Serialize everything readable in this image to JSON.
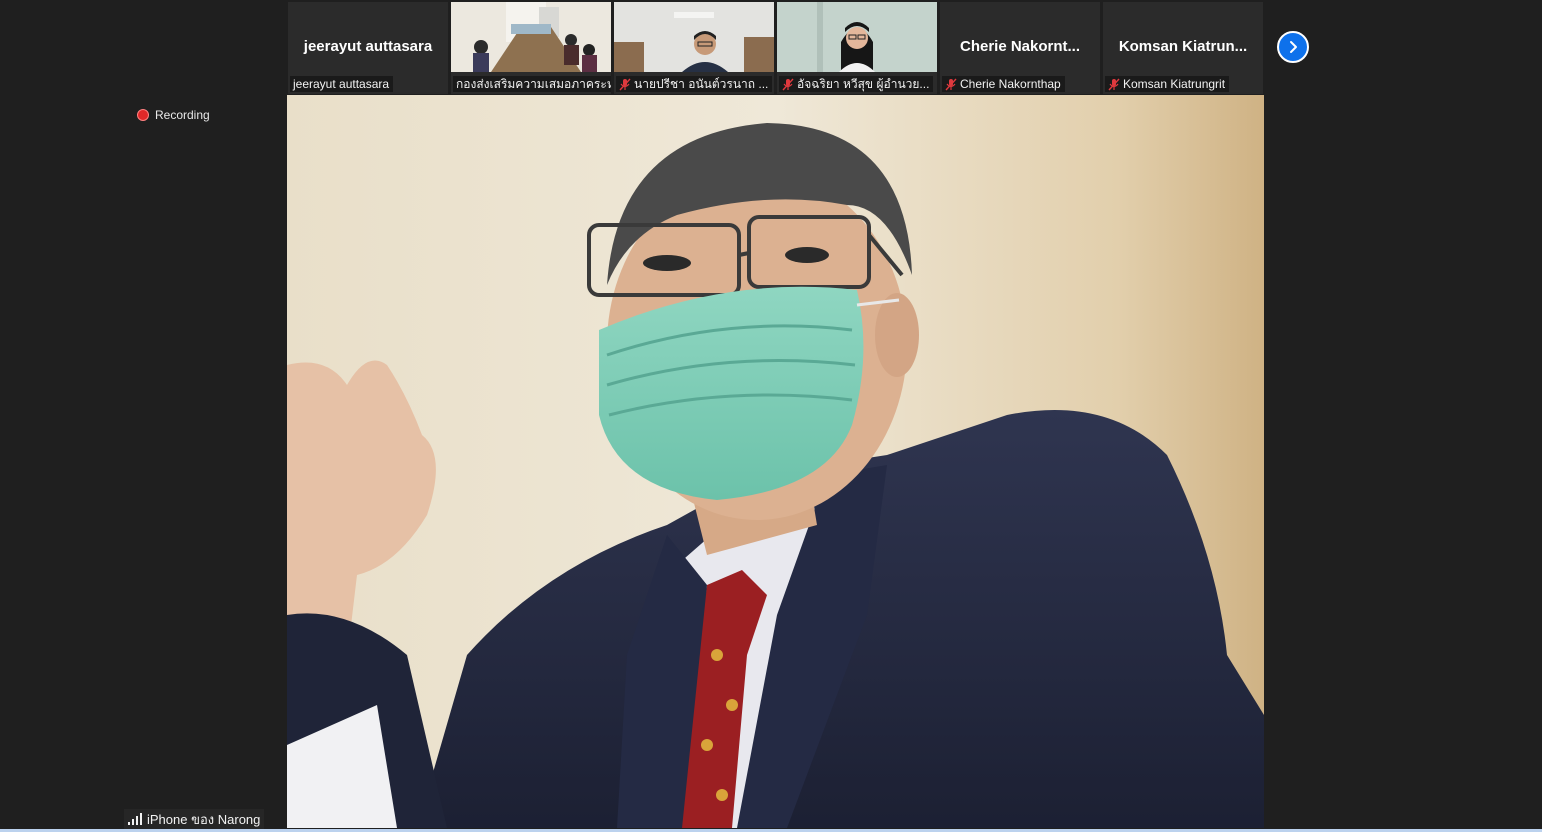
{
  "meeting": {
    "recording_label": "Recording"
  },
  "thumbnails": [
    {
      "big_name": "jeerayut auttasara",
      "label": "jeerayut auttasara",
      "muted": false,
      "video": false
    },
    {
      "big_name": "",
      "label": "กองส่งเสริมความเสมอภาคระห...",
      "muted": false,
      "video": true
    },
    {
      "big_name": "",
      "label": "นายปรีชา อนันต์วรนาถ ...",
      "muted": true,
      "video": true
    },
    {
      "big_name": "",
      "label": "อัจฉริยา หวีสุข ผู้อำนวย...",
      "muted": true,
      "video": true
    },
    {
      "big_name": "Cherie  Nakornt...",
      "label": "Cherie Nakornthap",
      "muted": true,
      "video": false
    },
    {
      "big_name": "Komsan  Kiatrun...",
      "label": "Komsan Kiatrungrit",
      "muted": true,
      "video": false
    }
  ],
  "speaker": {
    "name": "iPhone ของ Narong"
  },
  "icons": {
    "next": "chevron-right-icon",
    "muted": "mic-muted-icon",
    "signal": "signal-bars-icon",
    "recording": "record-dot-icon"
  },
  "colors": {
    "background": "#1f1f1f",
    "tile": "#2b2b2b",
    "accent": "#0e71eb",
    "recording": "#e02828",
    "muted": "#e0393e"
  }
}
